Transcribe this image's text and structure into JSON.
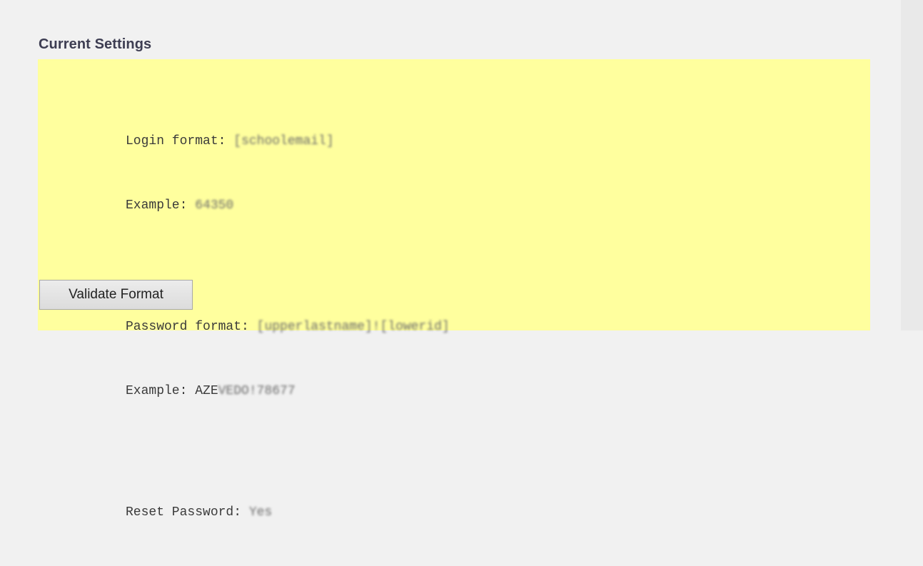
{
  "section": {
    "title": "Current Settings"
  },
  "settings": {
    "login_label": "Login format: ",
    "login_value": "[schoolemail]",
    "login_example_label": "Example: ",
    "login_example_value": "64350",
    "password_label": "Password format: ",
    "password_value": "[upperlastname]![lowerid]",
    "password_example_label": "Example: AZE",
    "password_example_value": "VEDO!78677",
    "reset_label": "Reset Password: ",
    "reset_value": "Yes"
  },
  "actions": {
    "validate_label": "Validate Format"
  },
  "colors": {
    "panel_bg": "#ffff9e",
    "page_bg": "#f1f1f1",
    "title_color": "#3d3d52"
  }
}
